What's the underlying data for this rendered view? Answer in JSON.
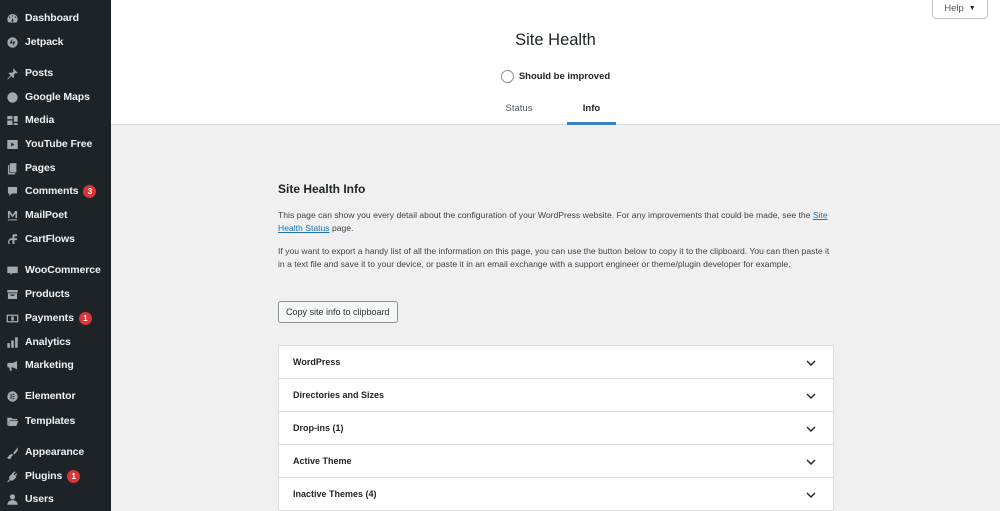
{
  "sidebar": {
    "items": [
      {
        "label": "Dashboard",
        "icon": "dashboard-icon"
      },
      {
        "label": "Jetpack",
        "icon": "jetpack-icon"
      },
      {
        "label": "Posts",
        "icon": "pin-icon"
      },
      {
        "label": "Google Maps",
        "icon": "globe-icon"
      },
      {
        "label": "Media",
        "icon": "media-icon"
      },
      {
        "label": "YouTube Free",
        "icon": "youtube-icon"
      },
      {
        "label": "Pages",
        "icon": "pages-icon"
      },
      {
        "label": "Comments",
        "icon": "comment-icon",
        "badge": "3"
      },
      {
        "label": "MailPoet",
        "icon": "mailpoet-icon"
      },
      {
        "label": "CartFlows",
        "icon": "cartflows-icon"
      },
      {
        "label": "WooCommerce",
        "icon": "woocommerce-icon"
      },
      {
        "label": "Products",
        "icon": "archive-icon"
      },
      {
        "label": "Payments",
        "icon": "money-icon",
        "badge": "1"
      },
      {
        "label": "Analytics",
        "icon": "bar-chart-icon"
      },
      {
        "label": "Marketing",
        "icon": "megaphone-icon"
      },
      {
        "label": "Elementor",
        "icon": "elementor-icon"
      },
      {
        "label": "Templates",
        "icon": "folder-icon"
      },
      {
        "label": "Appearance",
        "icon": "brush-icon"
      },
      {
        "label": "Plugins",
        "icon": "plug-icon",
        "badge": "1"
      },
      {
        "label": "Users",
        "icon": "user-icon"
      }
    ]
  },
  "header": {
    "help_label": "Help",
    "help_caret": "▼",
    "title": "Site Health",
    "status_text": "Should be improved",
    "tabs": [
      {
        "label": "Status",
        "active": false
      },
      {
        "label": "Info",
        "active": true
      }
    ]
  },
  "main": {
    "section_title": "Site Health Info",
    "para1_before": "This page can show you every detail about the configuration of your WordPress website. For any improvements that could be made, see the ",
    "para1_link": "Site Health Status",
    "para1_after": " page.",
    "para2": "If you want to export a handy list of all the information on this page, you can use the button below to copy it to the clipboard. You can then paste it in a text file and save it to your device, or paste it in an email exchange with a support engineer or theme/plugin developer for example.",
    "copy_button": "Copy site info to clipboard",
    "accordion": [
      {
        "label": "WordPress"
      },
      {
        "label": "Directories and Sizes"
      },
      {
        "label": "Drop-ins (1)"
      },
      {
        "label": "Active Theme"
      },
      {
        "label": "Inactive Themes (4)"
      }
    ]
  },
  "colors": {
    "sidebar_bg": "#1d2327",
    "accent": "#3582c4",
    "link": "#2271b1",
    "badge": "#d63638",
    "page_bg": "#f0f0f1"
  }
}
